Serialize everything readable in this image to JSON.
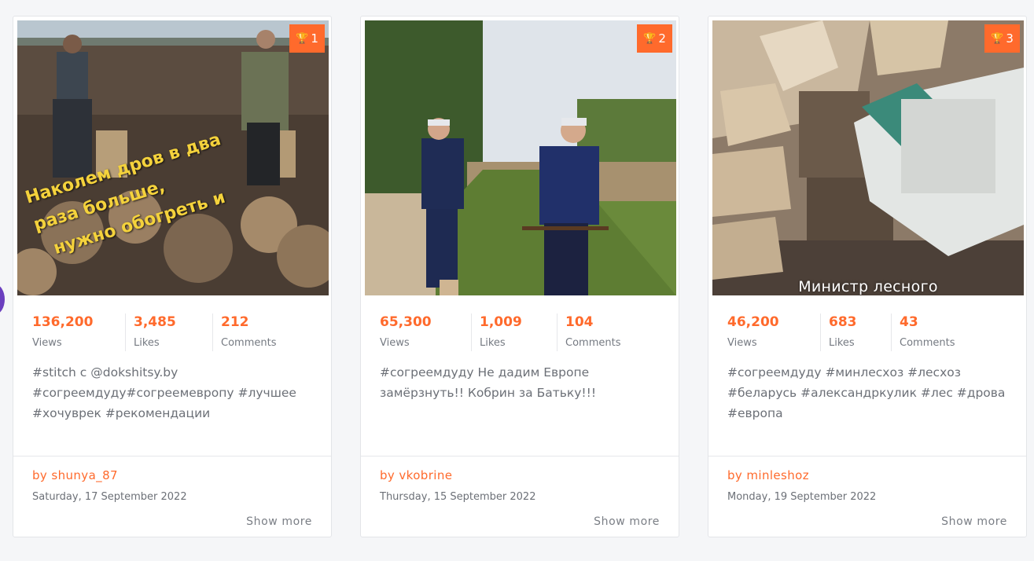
{
  "cards": [
    {
      "rank": "1",
      "overlay_text": "Наколем дров в два\nраза больше,\n  нужно обогреть и",
      "stats": {
        "views": "136,200",
        "likes": "3,485",
        "comments": "212"
      },
      "labels": {
        "views": "Views",
        "likes": "Likes",
        "comments": "Comments"
      },
      "description": "#stitch с @dokshitsy.by #согреемдуду#согреемевропу #лучшее #хочуврек #рекомендации",
      "author": "by shunya_87",
      "date": "Saturday, 17 September 2022",
      "show_more": "Show more"
    },
    {
      "rank": "2",
      "stats": {
        "views": "65,300",
        "likes": "1,009",
        "comments": "104"
      },
      "labels": {
        "views": "Views",
        "likes": "Likes",
        "comments": "Comments"
      },
      "description": "#согреемдуду Не дадим Европе замёрзнуть!! Кобрин за Батьку!!!",
      "author": "by vkobrine",
      "date": "Thursday, 15 September 2022",
      "show_more": "Show more"
    },
    {
      "rank": "3",
      "overlay_text": "Министр лесного",
      "stats": {
        "views": "46,200",
        "likes": "683",
        "comments": "43"
      },
      "labels": {
        "views": "Views",
        "likes": "Likes",
        "comments": "Comments"
      },
      "description": "#согреемдуду #минлесхоз #лесхоз #беларусь #александркулик #лес #дрова #европа",
      "author": "by minleshoz",
      "date": "Monday, 19 September 2022",
      "show_more": "Show more"
    }
  ],
  "colors": {
    "accent": "#ff6a2c",
    "text_muted": "#6c7077",
    "border": "#e6e7ea",
    "background": "#f5f6f8"
  },
  "icons": {
    "rank": "trophy-icon"
  }
}
